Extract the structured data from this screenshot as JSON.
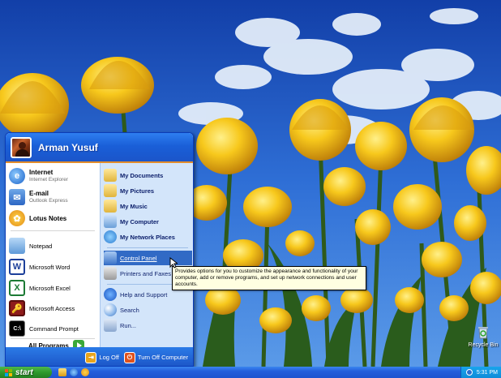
{
  "desktop": {
    "recycle_bin_label": "Recycle Bin"
  },
  "start_menu": {
    "user_name": "Arman Yusuf",
    "pinned": [
      {
        "title": "Internet",
        "subtitle": "Internet Explorer",
        "icon": "internet-explorer-icon"
      },
      {
        "title": "E-mail",
        "subtitle": "Outlook Express",
        "icon": "outlook-express-icon"
      },
      {
        "title": "Lotus Notes",
        "subtitle": "",
        "icon": "lotus-notes-icon"
      }
    ],
    "recent": [
      {
        "label": "Notepad",
        "icon": "notepad-icon"
      },
      {
        "label": "Microsoft Word",
        "icon": "word-icon"
      },
      {
        "label": "Microsoft Excel",
        "icon": "excel-icon"
      },
      {
        "label": "Microsoft Access",
        "icon": "access-icon"
      },
      {
        "label": "Command Prompt",
        "icon": "command-prompt-icon"
      }
    ],
    "all_programs_label": "All Programs",
    "right": [
      {
        "label": "My Documents",
        "icon": "my-documents-icon"
      },
      {
        "label": "My Pictures",
        "icon": "my-pictures-icon"
      },
      {
        "label": "My Music",
        "icon": "my-music-icon"
      },
      {
        "label": "My Computer",
        "icon": "my-computer-icon"
      },
      {
        "label": "My Network Places",
        "icon": "network-places-icon"
      },
      {
        "label": "Control Panel",
        "icon": "control-panel-icon"
      },
      {
        "label": "Printers and Faxes",
        "icon": "printer-icon"
      },
      {
        "label": "Help and Support",
        "icon": "help-icon"
      },
      {
        "label": "Search",
        "icon": "search-icon"
      },
      {
        "label": "Run...",
        "icon": "run-icon"
      }
    ],
    "log_off_label": "Log Off",
    "turn_off_label": "Turn Off Computer"
  },
  "tooltip": {
    "text": "Provides options for you to customize the appearance and functionality of your computer, add or remove programs, and set up network connections and user accounts."
  },
  "taskbar": {
    "start_label": "start",
    "clock": "5:31 PM"
  },
  "colors": {
    "taskbar_blue": "#245edb",
    "start_green": "#2f9a2c",
    "highlight": "#316ac5",
    "tooltip_bg": "#ffffe1"
  }
}
